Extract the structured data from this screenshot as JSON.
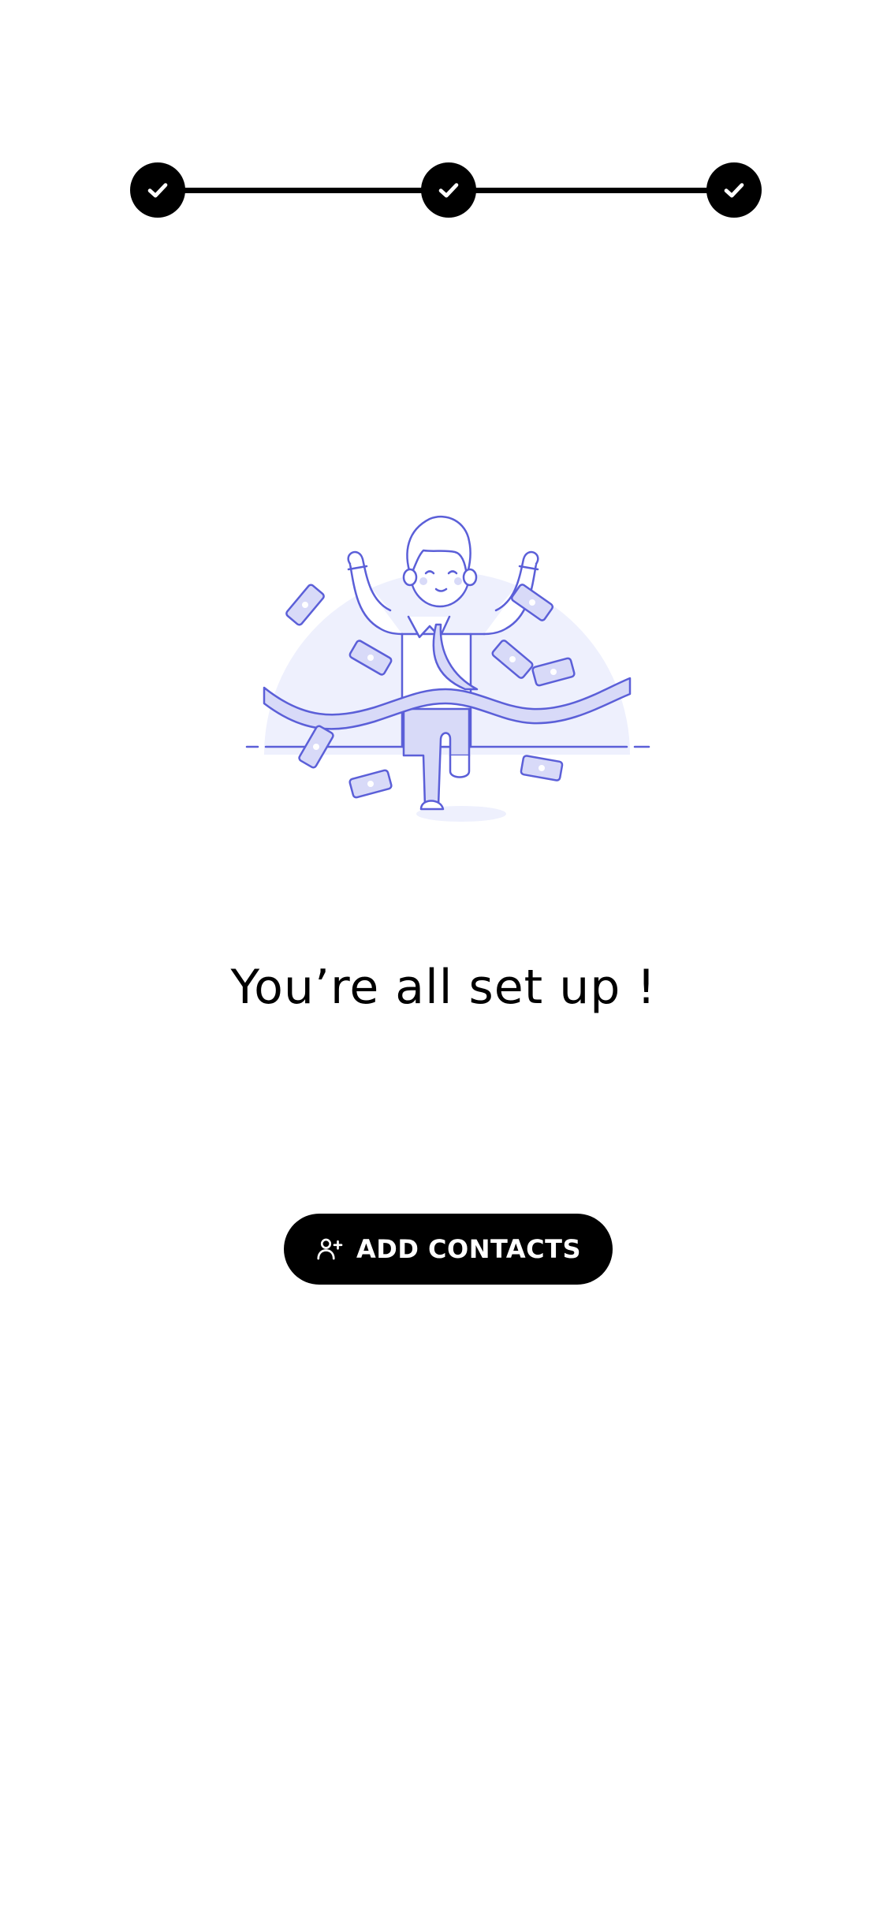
{
  "stepper": {
    "steps": [
      {
        "state": "completed",
        "icon": "check-icon"
      },
      {
        "state": "completed",
        "icon": "check-icon"
      },
      {
        "state": "completed",
        "icon": "check-icon"
      }
    ]
  },
  "illustration": {
    "icon": "celebrating-man-finish-line-illustration",
    "accent_color": "#5B5FD8",
    "fill_color": "#D8DAF8",
    "background_circle_color": "#EEF0FD"
  },
  "main": {
    "headline": "You’re all set up !"
  },
  "actions": {
    "add_contacts_label": "ADD CONTACTS",
    "add_contacts_icon": "add-user-icon"
  },
  "colors": {
    "primary": "#000000",
    "on_primary": "#FFFFFF",
    "background": "#FFFFFF"
  }
}
